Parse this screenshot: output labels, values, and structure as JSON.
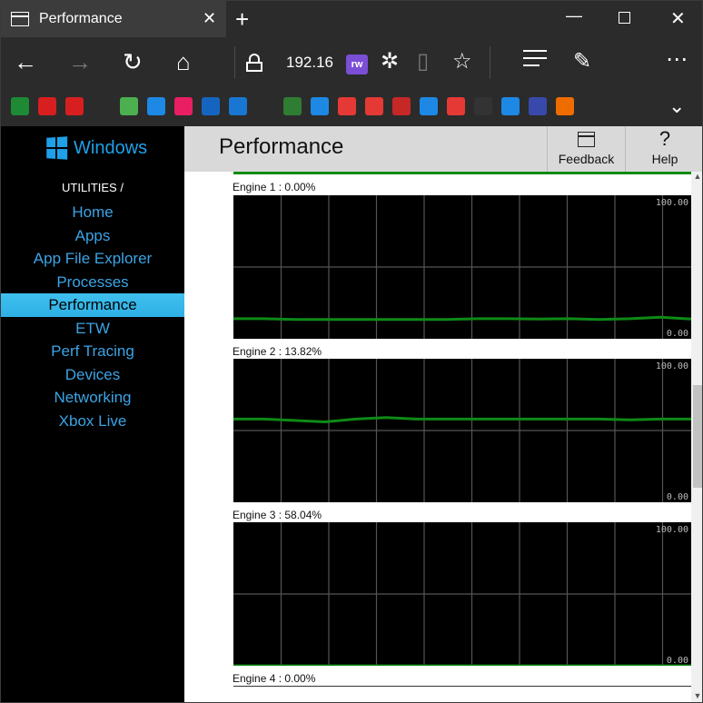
{
  "browser": {
    "tab_title": "Performance",
    "address": "192.16",
    "fav_colors": [
      "#1e8a35",
      "#d71f1f",
      "#d71f1f",
      "#2b2b2b",
      "#4caf50",
      "#1e88e5",
      "#e91e63",
      "#1565c0",
      "#1976d2",
      "#2b2b2b",
      "#2e7d32",
      "#1e88e5",
      "#e53935",
      "#e53935",
      "#c62828",
      "#1e88e5",
      "#e53935",
      "#333333",
      "#1e88e5",
      "#3949ab",
      "#ef6c00",
      "#2b2b2b",
      "#2b2b2b"
    ]
  },
  "sidebar": {
    "logo_text": "Windows",
    "section_label": "UTILITIES /",
    "items": [
      {
        "label": "Home"
      },
      {
        "label": "Apps"
      },
      {
        "label": "App File Explorer"
      },
      {
        "label": "Processes"
      },
      {
        "label": "Performance"
      },
      {
        "label": "ETW"
      },
      {
        "label": "Perf Tracing"
      },
      {
        "label": "Devices"
      },
      {
        "label": "Networking"
      },
      {
        "label": "Xbox Live"
      }
    ],
    "active_item": "Performance"
  },
  "header": {
    "title": "Performance",
    "feedback_label": "Feedback",
    "help_label": "Help"
  },
  "engines": [
    {
      "label": "Engine 1 : 0.00%"
    },
    {
      "label": "Engine 2 : 13.82%"
    },
    {
      "label": "Engine 3 : 58.04%"
    },
    {
      "label": "Engine 4 : 0.00%"
    }
  ],
  "chart_data": [
    {
      "type": "line",
      "y_max_label": "100.00",
      "y_min_label": "0.00",
      "ylim": [
        0,
        100
      ],
      "grid": true,
      "values": [
        14,
        14,
        13.5,
        13.5,
        13.5,
        13.5,
        13.5,
        13.5,
        14,
        14,
        13.8,
        14,
        13.5,
        14,
        15,
        13.8
      ]
    },
    {
      "type": "line",
      "y_max_label": "100.00",
      "y_min_label": "0.00",
      "ylim": [
        0,
        100
      ],
      "grid": true,
      "values": [
        58,
        58,
        57,
        56,
        58,
        59,
        58,
        58,
        58,
        58,
        58,
        58,
        58,
        57.5,
        58,
        58
      ]
    },
    {
      "type": "line",
      "y_max_label": "100.00",
      "y_min_label": "0.00",
      "ylim": [
        0,
        100
      ],
      "grid": true,
      "values": [
        0,
        0,
        0,
        0,
        0,
        0,
        0,
        0,
        0,
        0,
        0,
        0,
        0,
        0,
        0,
        0
      ]
    }
  ]
}
